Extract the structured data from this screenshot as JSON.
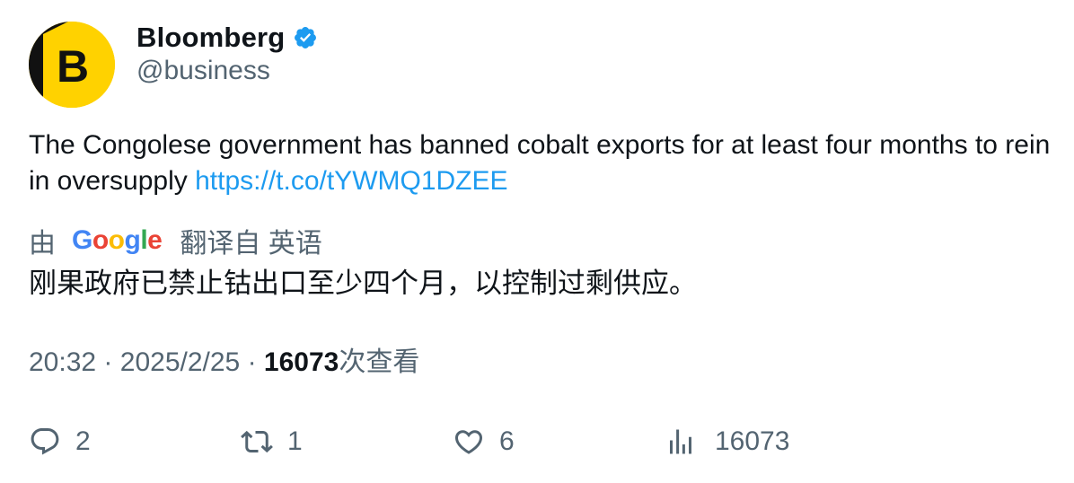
{
  "author": {
    "name": "Bloomberg",
    "handle": "@business",
    "avatar_letter": "B",
    "avatar_color": "#ffd200",
    "verified": true,
    "verified_color": "#1d9bf0"
  },
  "tweet": {
    "text": "The Congolese government has banned cobalt exports for at least four months to rein in oversupply",
    "link": "https://t.co/tYWMQ1DZEE",
    "link_color": "#1d9bf0"
  },
  "translation": {
    "prefix": "由",
    "provider_letters": [
      "G",
      "o",
      "o",
      "g",
      "l",
      "e"
    ],
    "suffix": "翻译自 英语",
    "text": "刚果政府已禁止钴出口至少四个月，以控制过剩供应。"
  },
  "meta": {
    "time": "20:32",
    "separator": "·",
    "date": "2025/2/25",
    "views_count": "16073",
    "views_label": "次查看"
  },
  "actions": {
    "reply_count": "2",
    "retweet_count": "1",
    "like_count": "6",
    "views_count": "16073",
    "icons": [
      "reply-icon",
      "retweet-icon",
      "like-icon",
      "views-icon"
    ]
  }
}
